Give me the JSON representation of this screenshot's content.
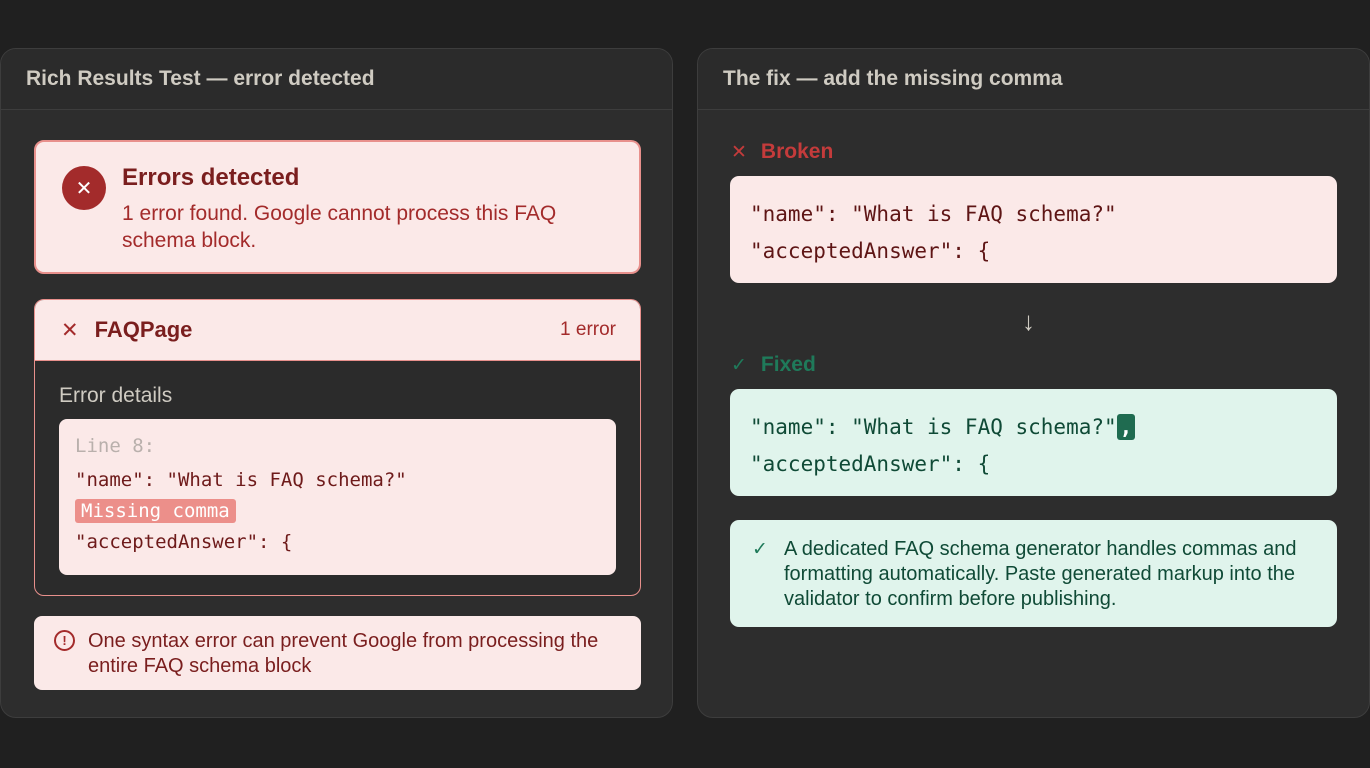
{
  "left_panel": {
    "title": "Rich Results Test — error detected",
    "banner": {
      "title": "Errors detected",
      "description": "1 error found. Google cannot process this FAQ schema block."
    },
    "faq_card": {
      "type_name": "FAQPage",
      "error_count": "1 error",
      "details_label": "Error details",
      "code": {
        "line_label": "Line 8:",
        "line1": "\"name\": \"What is FAQ schema?\"",
        "badge": "Missing comma",
        "line2": "\"acceptedAnswer\": {"
      }
    },
    "note": "One syntax error can prevent Google from processing the entire FAQ schema block"
  },
  "right_panel": {
    "title": "The fix — add the missing comma",
    "broken": {
      "label": "Broken",
      "line1": "\"name\": \"What is FAQ schema?\"",
      "line2": "\"acceptedAnswer\": {"
    },
    "fixed": {
      "label": "Fixed",
      "line1": "\"name\": \"What is FAQ schema?\"",
      "comma": ",",
      "line2": "\"acceptedAnswer\": {"
    },
    "tip": "A dedicated FAQ schema generator handles commas and formatting automatically. Paste generated markup into the validator to confirm before publishing."
  },
  "icons": {
    "error": "x-circle-icon",
    "close": "close-icon",
    "info": "info-circle-icon",
    "arrow": "arrow-down-icon",
    "check": "check-icon"
  },
  "colors": {
    "background": "#202020",
    "panel": "#2d2d2d",
    "error_light": "#fbe9e8",
    "error_dark": "#a32b2b",
    "success_light": "#e0f4ec",
    "success_dark": "#1f7a5a"
  }
}
